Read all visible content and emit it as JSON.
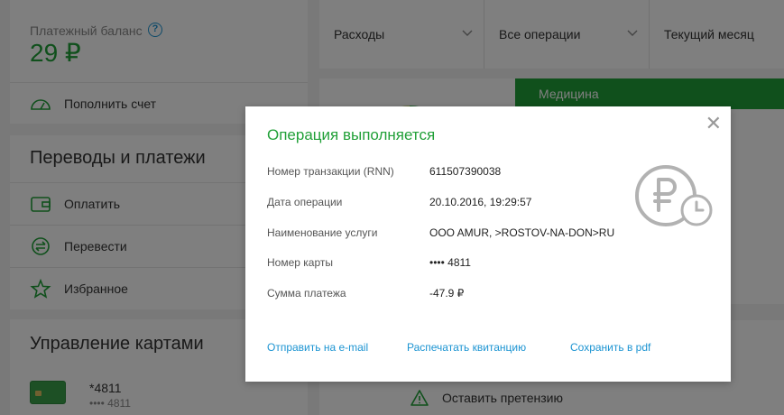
{
  "balance": {
    "label": "Платежный баланс",
    "amount": "29 ₽",
    "help_icon": "?",
    "topup_label": "Пополнить счет"
  },
  "transfers": {
    "title": "Переводы и платежи",
    "items": [
      {
        "label": "Оплатить",
        "icon": "wallet-icon"
      },
      {
        "label": "Перевести",
        "icon": "transfer-icon"
      },
      {
        "label": "Избранное",
        "icon": "star-icon"
      }
    ]
  },
  "cards": {
    "title": "Управление картами",
    "card_name": "*4811",
    "card_mask": "•••• 4811"
  },
  "filters": [
    "Расходы",
    "Все операции",
    "Текущий месяц"
  ],
  "category_tab": "Медицина",
  "complaint_label": "Оставить претензию",
  "modal": {
    "title": "Операция выполняется",
    "close_glyph": "✕",
    "fields": [
      {
        "label": "Номер транзакции (RNN)",
        "value": "611507390038"
      },
      {
        "label": "Дата операции",
        "value": "20.10.2016, 19:29:57"
      },
      {
        "label": "Наименование услуги",
        "value": "OOO AMUR, >ROSTOV-NA-DON>RU"
      },
      {
        "label": "Номер карты",
        "value": "•••• 4811"
      },
      {
        "label": "Сумма платежа",
        "value": "-47.9 ₽"
      }
    ],
    "status_icon": "ruble-pending-icon",
    "actions": [
      "Отправить на e-mail",
      "Распечатать квитанцию",
      "Сохранить в pdf"
    ]
  },
  "colors": {
    "brand_green": "#21a038",
    "link_blue": "#1c94d2",
    "tab_green": "#21a038"
  }
}
